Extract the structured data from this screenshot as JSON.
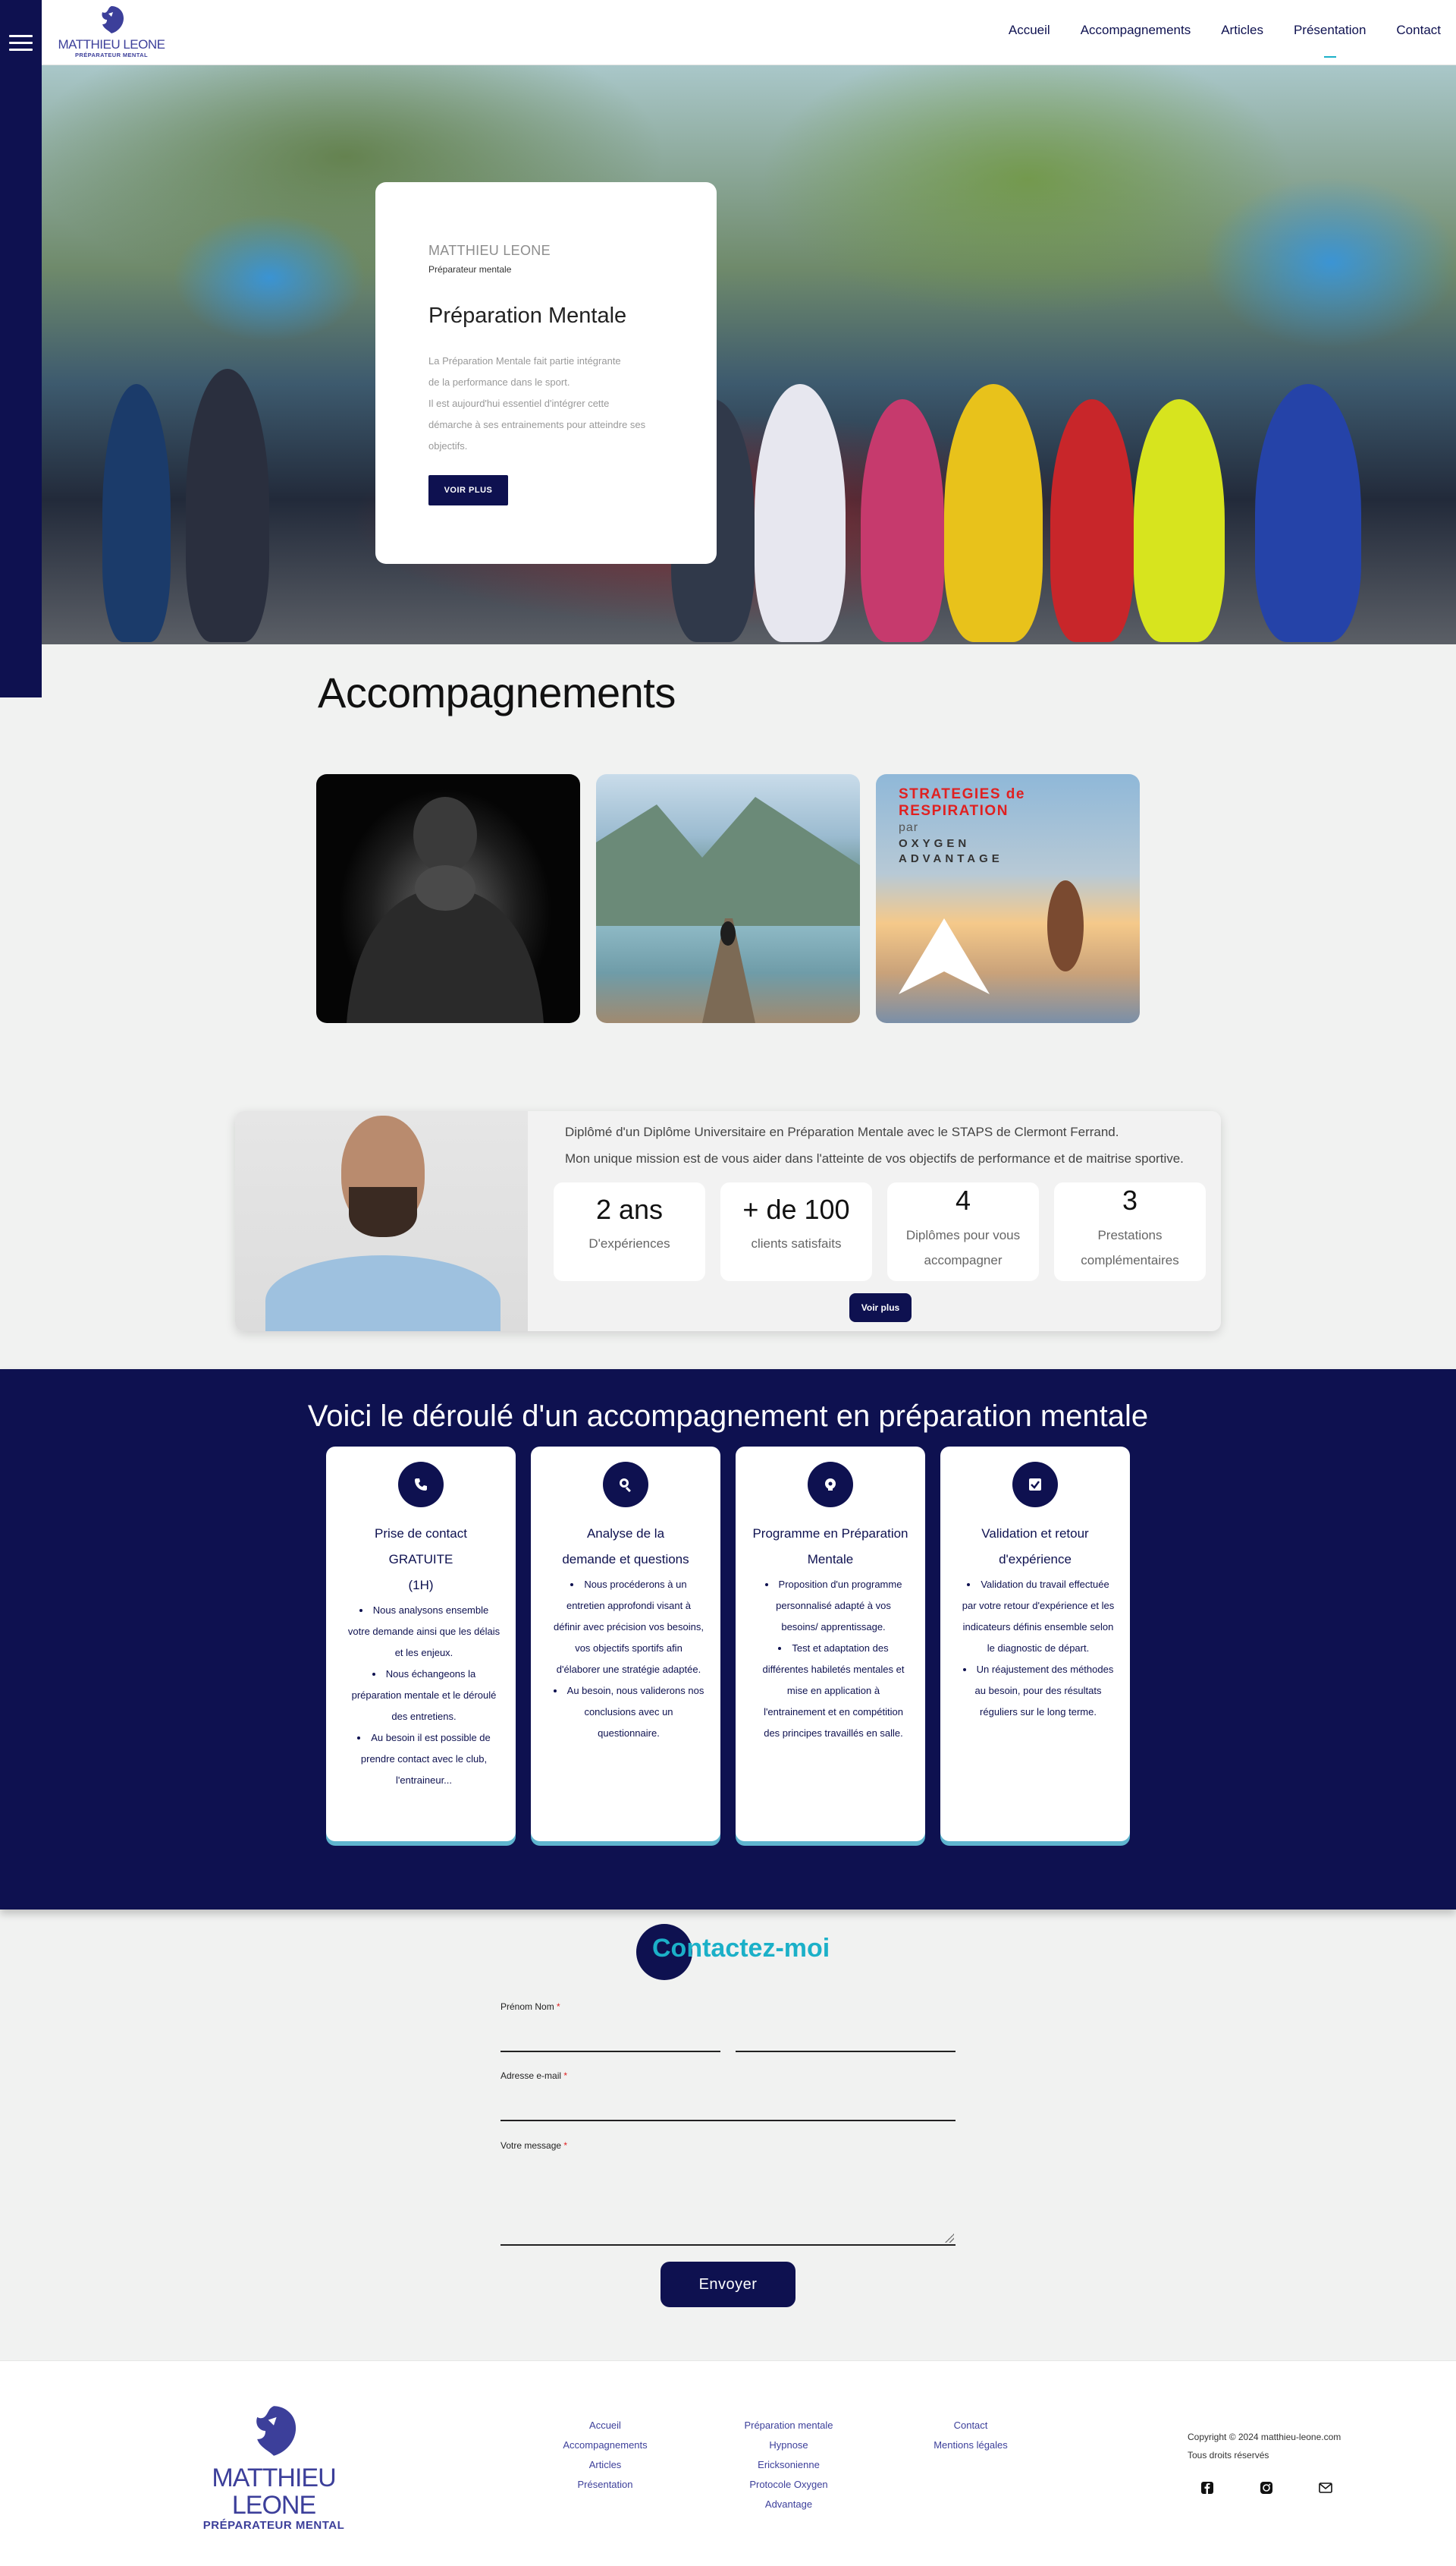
{
  "header": {
    "logo_name": "MATTHIEU LEONE",
    "logo_sub": "PRÉPARATEUR MENTAL",
    "nav": [
      "Accueil",
      "Accompagnements",
      "Articles",
      "Présentation",
      "Contact"
    ]
  },
  "hero": {
    "overline": "MATTHIEU LEONE",
    "role": "Préparateur mentale",
    "title": "Préparation Mentale",
    "desc_lines": [
      "La Préparation Mentale fait partie intégrante",
      "de la performance dans le sport.",
      "Il est aujourd'hui essentiel d'intégrer cette",
      "démarche à ses entrainements pour atteindre ses",
      "objectifs."
    ],
    "button": "VOIR PLUS"
  },
  "accompagnements": {
    "title": "Accompagnements",
    "card3_lines": [
      "STRATEGIES de",
      "RESPIRATION",
      "par",
      "OXYGEN",
      "ADVANTAGE"
    ]
  },
  "profile": {
    "line1": "Diplômé d'un Diplôme Universitaire en Préparation Mentale avec le STAPS de Clermont Ferrand.",
    "line2": "Mon unique mission est de vous aider dans l'atteinte de vos objectifs de performance et de maitrise sportive.",
    "stats": [
      {
        "num": "2 ans",
        "label": "D'expériences"
      },
      {
        "num": "+ de 100",
        "label": "clients satisfaits"
      },
      {
        "num": "4",
        "label": "Diplômes pour vous",
        "label2": "accompagner"
      },
      {
        "num": "3",
        "label": "Prestations",
        "label2": "complémentaires"
      }
    ],
    "button": "Voir plus"
  },
  "process": {
    "title": "Voici le déroulé d'un accompagnement en préparation mentale",
    "steps": [
      {
        "icon": "phone-icon",
        "title1": "Prise de contact GRATUITE",
        "title2": "(1H)",
        "items": [
          "Nous analysons ensemble votre demande ainsi que les délais et les enjeux.",
          "Nous échangeons la préparation mentale et le déroulé des entretiens.",
          "Au besoin il est possible de prendre contact avec le club, l'entraineur..."
        ]
      },
      {
        "icon": "search-icon",
        "title1": "Analyse de la",
        "title2": "demande et questions",
        "items": [
          "Nous procéderons à un entretien approfondi visant à définir avec précision vos besoins, vos objectifs sportifs afin d'élaborer une stratégie adaptée.",
          "Au besoin, nous validerons nos conclusions avec un questionnaire."
        ]
      },
      {
        "icon": "brain-icon",
        "title1": "Programme en Préparation",
        "title2": "Mentale",
        "items": [
          "Proposition d'un programme personnalisé adapté à vos besoins/ apprentissage.",
          "Test et adaptation des différentes habiletés mentales et mise en application à l'entrainement et en compétition des principes travaillés en salle."
        ]
      },
      {
        "icon": "check-icon",
        "title1": "Validation et retour",
        "title2": "d'expérience",
        "items": [
          "Validation du travail effectuée par votre retour d'expérience et les indicateurs définis ensemble selon le diagnostic de départ.",
          "Un réajustement des méthodes au besoin, pour des résultats réguliers sur le long terme."
        ]
      }
    ]
  },
  "contact": {
    "title": "Contactez-moi",
    "name_label": "Prénom Nom",
    "email_label": "Adresse e-mail",
    "message_label": "Votre message",
    "required_mark": "*",
    "send": "Envoyer"
  },
  "footer": {
    "logo_name": "MATTHIEU LEONE",
    "logo_sub": "PRÉPARATEUR MENTAL",
    "col1": [
      "Accueil",
      "Accompagnements",
      "Articles",
      "Présentation"
    ],
    "col2": [
      "Préparation mentale",
      "Hypnose",
      "Ericksonienne",
      "Protocole Oxygen",
      "Advantage"
    ],
    "col3": [
      "Contact",
      "Mentions légales"
    ],
    "copyright": "Copyright © 2024 matthieu-leone.com",
    "rights": "Tous droits réservés",
    "social_icons": [
      "facebook-icon",
      "instagram-icon",
      "email-icon"
    ]
  },
  "colors": {
    "primary": "#0e1150",
    "accent": "#1bb0c8",
    "required": "#e02020"
  }
}
